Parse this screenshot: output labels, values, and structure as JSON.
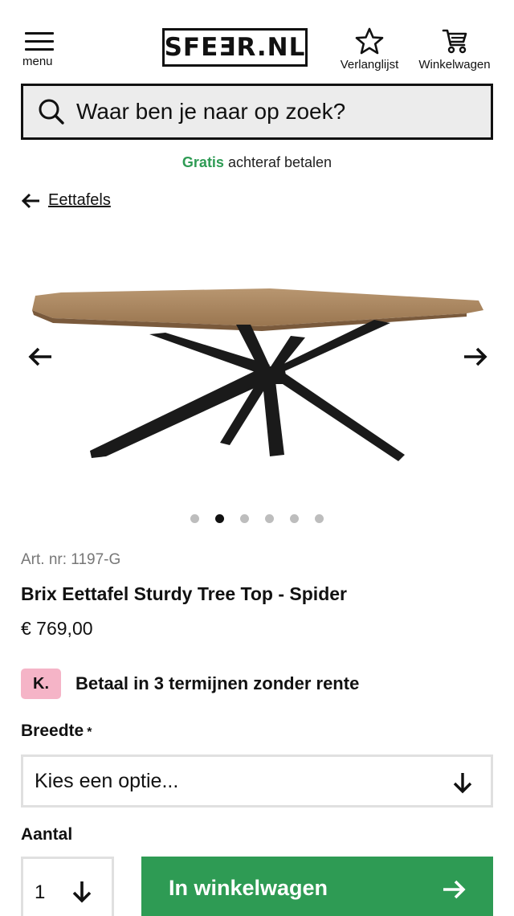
{
  "header": {
    "menu_label": "menu",
    "logo_text": "SFEƎR.NL",
    "wishlist_label": "Verlanglijst",
    "cart_label": "Winkelwagen"
  },
  "search": {
    "placeholder": "Waar ben je naar op zoek?"
  },
  "promo": {
    "highlight": "Gratis",
    "text": "achteraf betalen"
  },
  "breadcrumb": {
    "label": "Eettafels"
  },
  "gallery": {
    "slide_count": 6,
    "active_index": 1
  },
  "product": {
    "art_nr": "Art. nr: 1197-G",
    "title": "Brix Eettafel Sturdy Tree Top - Spider",
    "price": "€ 769,00"
  },
  "klarna": {
    "badge": "K.",
    "text": "Betaal in 3 termijnen zonder rente"
  },
  "options": {
    "width_label": "Breedte",
    "required_mark": "*",
    "width_value": "Kies een optie..."
  },
  "quantity": {
    "label": "Aantal",
    "value": "1"
  },
  "add_to_cart": {
    "label": "In winkelwagen"
  },
  "colors": {
    "accent_green": "#2e9b54",
    "klarna_pink": "#f5b4c7",
    "search_bg": "#ececec"
  }
}
